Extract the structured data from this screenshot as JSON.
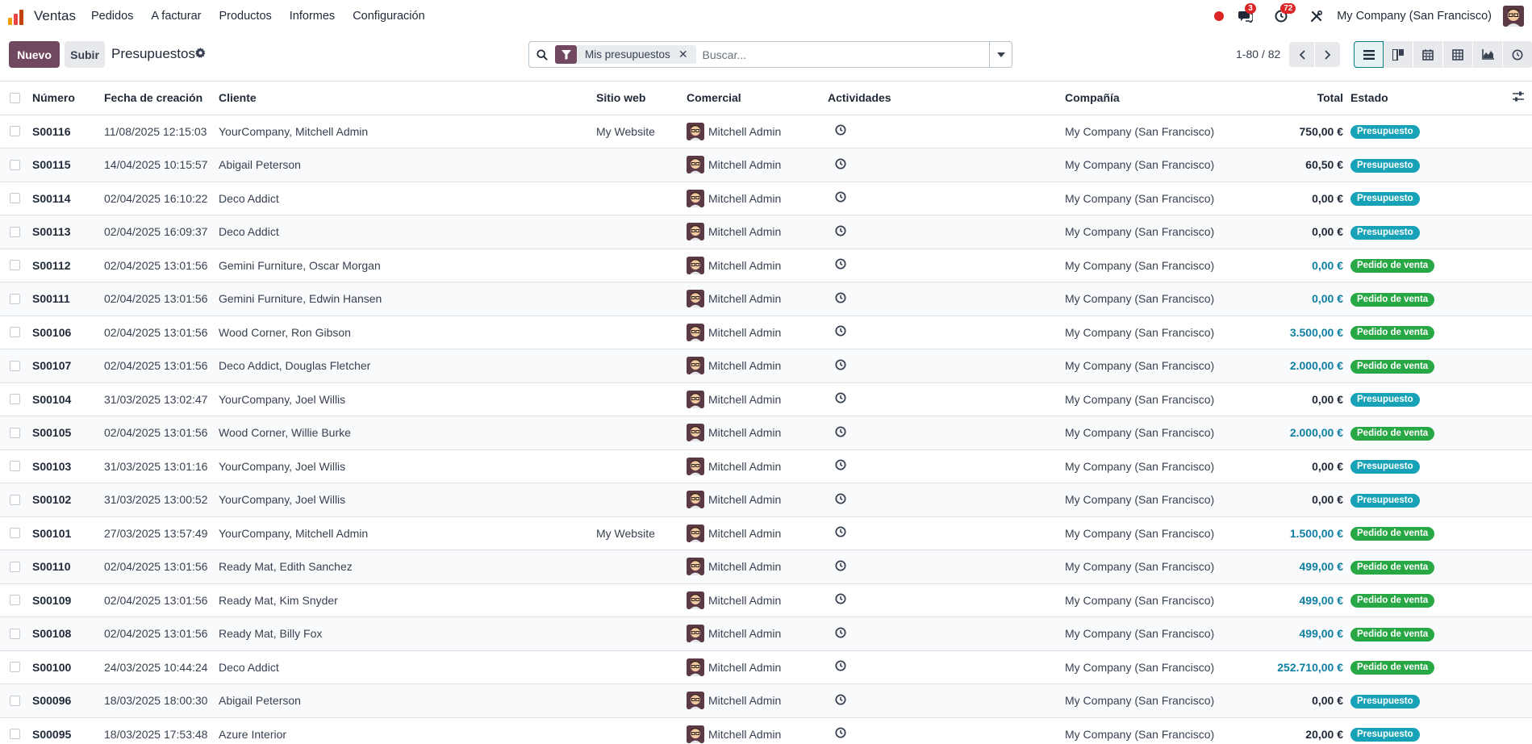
{
  "nav": {
    "brand": "Ventas",
    "menu": [
      "Pedidos",
      "A facturar",
      "Productos",
      "Informes",
      "Configuración"
    ],
    "chat_count": "3",
    "activity_count": "72",
    "company": "My Company (San Francisco)",
    "icons": [
      "ventas-logo-icon",
      "record-dot-icon",
      "chat-icon",
      "clock-icon",
      "tools-icon",
      "user-avatar"
    ]
  },
  "control": {
    "new_label": "Nuevo",
    "upload_label": "Subir",
    "title": "Presupuestos",
    "facet_label": "Mis presupuestos",
    "search_placeholder": "Buscar...",
    "pager": "1-80 / 82",
    "views": [
      "list-view-icon",
      "kanban-view-icon",
      "calendar-view-icon",
      "pivot-view-icon",
      "graph-view-icon",
      "activity-view-icon"
    ]
  },
  "table": {
    "columns": [
      "Número",
      "Fecha de creación",
      "Cliente",
      "Sitio web",
      "Comercial",
      "Actividades",
      "Compañía",
      "Total",
      "Estado"
    ],
    "rows": [
      {
        "num": "S00116",
        "date": "11/08/2025 12:15:03",
        "customer": "YourCompany, Mitchell Admin",
        "website": "My Website",
        "salesperson": "Mitchell Admin",
        "company": "My Company (San Francisco)",
        "total": "750,00 €",
        "state": "Presupuesto"
      },
      {
        "num": "S00115",
        "date": "14/04/2025 10:15:57",
        "customer": "Abigail Peterson",
        "website": "",
        "salesperson": "Mitchell Admin",
        "company": "My Company (San Francisco)",
        "total": "60,50 €",
        "state": "Presupuesto"
      },
      {
        "num": "S00114",
        "date": "02/04/2025 16:10:22",
        "customer": "Deco Addict",
        "website": "",
        "salesperson": "Mitchell Admin",
        "company": "My Company (San Francisco)",
        "total": "0,00 €",
        "state": "Presupuesto"
      },
      {
        "num": "S00113",
        "date": "02/04/2025 16:09:37",
        "customer": "Deco Addict",
        "website": "",
        "salesperson": "Mitchell Admin",
        "company": "My Company (San Francisco)",
        "total": "0,00 €",
        "state": "Presupuesto"
      },
      {
        "num": "S00112",
        "date": "02/04/2025 13:01:56",
        "customer": "Gemini Furniture, Oscar Morgan",
        "website": "",
        "salesperson": "Mitchell Admin",
        "company": "My Company (San Francisco)",
        "total": "0,00 €",
        "state": "Pedido de venta"
      },
      {
        "num": "S00111",
        "date": "02/04/2025 13:01:56",
        "customer": "Gemini Furniture, Edwin Hansen",
        "website": "",
        "salesperson": "Mitchell Admin",
        "company": "My Company (San Francisco)",
        "total": "0,00 €",
        "state": "Pedido de venta"
      },
      {
        "num": "S00106",
        "date": "02/04/2025 13:01:56",
        "customer": "Wood Corner, Ron Gibson",
        "website": "",
        "salesperson": "Mitchell Admin",
        "company": "My Company (San Francisco)",
        "total": "3.500,00 €",
        "state": "Pedido de venta"
      },
      {
        "num": "S00107",
        "date": "02/04/2025 13:01:56",
        "customer": "Deco Addict, Douglas Fletcher",
        "website": "",
        "salesperson": "Mitchell Admin",
        "company": "My Company (San Francisco)",
        "total": "2.000,00 €",
        "state": "Pedido de venta"
      },
      {
        "num": "S00104",
        "date": "31/03/2025 13:02:47",
        "customer": "YourCompany, Joel Willis",
        "website": "",
        "salesperson": "Mitchell Admin",
        "company": "My Company (San Francisco)",
        "total": "0,00 €",
        "state": "Presupuesto"
      },
      {
        "num": "S00105",
        "date": "02/04/2025 13:01:56",
        "customer": "Wood Corner, Willie Burke",
        "website": "",
        "salesperson": "Mitchell Admin",
        "company": "My Company (San Francisco)",
        "total": "2.000,00 €",
        "state": "Pedido de venta"
      },
      {
        "num": "S00103",
        "date": "31/03/2025 13:01:16",
        "customer": "YourCompany, Joel Willis",
        "website": "",
        "salesperson": "Mitchell Admin",
        "company": "My Company (San Francisco)",
        "total": "0,00 €",
        "state": "Presupuesto"
      },
      {
        "num": "S00102",
        "date": "31/03/2025 13:00:52",
        "customer": "YourCompany, Joel Willis",
        "website": "",
        "salesperson": "Mitchell Admin",
        "company": "My Company (San Francisco)",
        "total": "0,00 €",
        "state": "Presupuesto"
      },
      {
        "num": "S00101",
        "date": "27/03/2025 13:57:49",
        "customer": "YourCompany, Mitchell Admin",
        "website": "My Website",
        "salesperson": "Mitchell Admin",
        "company": "My Company (San Francisco)",
        "total": "1.500,00 €",
        "state": "Pedido de venta"
      },
      {
        "num": "S00110",
        "date": "02/04/2025 13:01:56",
        "customer": "Ready Mat, Edith Sanchez",
        "website": "",
        "salesperson": "Mitchell Admin",
        "company": "My Company (San Francisco)",
        "total": "499,00 €",
        "state": "Pedido de venta"
      },
      {
        "num": "S00109",
        "date": "02/04/2025 13:01:56",
        "customer": "Ready Mat, Kim Snyder",
        "website": "",
        "salesperson": "Mitchell Admin",
        "company": "My Company (San Francisco)",
        "total": "499,00 €",
        "state": "Pedido de venta"
      },
      {
        "num": "S00108",
        "date": "02/04/2025 13:01:56",
        "customer": "Ready Mat, Billy Fox",
        "website": "",
        "salesperson": "Mitchell Admin",
        "company": "My Company (San Francisco)",
        "total": "499,00 €",
        "state": "Pedido de venta"
      },
      {
        "num": "S00100",
        "date": "24/03/2025 10:44:24",
        "customer": "Deco Addict",
        "website": "",
        "salesperson": "Mitchell Admin",
        "company": "My Company (San Francisco)",
        "total": "252.710,00 €",
        "state": "Pedido de venta"
      },
      {
        "num": "S00096",
        "date": "18/03/2025 18:00:30",
        "customer": "Abigail Peterson",
        "website": "",
        "salesperson": "Mitchell Admin",
        "company": "My Company (San Francisco)",
        "total": "0,00 €",
        "state": "Presupuesto"
      },
      {
        "num": "S00095",
        "date": "18/03/2025 17:53:48",
        "customer": "Azure Interior",
        "website": "",
        "salesperson": "Mitchell Admin",
        "company": "My Company (San Francisco)",
        "total": "20,00 €",
        "state": "Presupuesto"
      }
    ]
  },
  "colors": {
    "primary": "#71485f",
    "quote_badge": "#17a2b8",
    "order_badge": "#28a745",
    "order_total": "#0e7fa3",
    "danger": "#dc2626"
  }
}
